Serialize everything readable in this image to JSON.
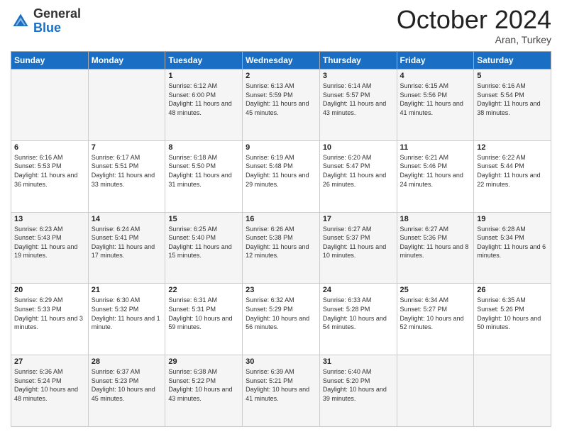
{
  "header": {
    "logo_general": "General",
    "logo_blue": "Blue",
    "month_title": "October 2024",
    "subtitle": "Aran, Turkey"
  },
  "days_of_week": [
    "Sunday",
    "Monday",
    "Tuesday",
    "Wednesday",
    "Thursday",
    "Friday",
    "Saturday"
  ],
  "weeks": [
    [
      {
        "day": "",
        "info": ""
      },
      {
        "day": "",
        "info": ""
      },
      {
        "day": "1",
        "info": "Sunrise: 6:12 AM\nSunset: 6:00 PM\nDaylight: 11 hours and 48 minutes."
      },
      {
        "day": "2",
        "info": "Sunrise: 6:13 AM\nSunset: 5:59 PM\nDaylight: 11 hours and 45 minutes."
      },
      {
        "day": "3",
        "info": "Sunrise: 6:14 AM\nSunset: 5:57 PM\nDaylight: 11 hours and 43 minutes."
      },
      {
        "day": "4",
        "info": "Sunrise: 6:15 AM\nSunset: 5:56 PM\nDaylight: 11 hours and 41 minutes."
      },
      {
        "day": "5",
        "info": "Sunrise: 6:16 AM\nSunset: 5:54 PM\nDaylight: 11 hours and 38 minutes."
      }
    ],
    [
      {
        "day": "6",
        "info": "Sunrise: 6:16 AM\nSunset: 5:53 PM\nDaylight: 11 hours and 36 minutes."
      },
      {
        "day": "7",
        "info": "Sunrise: 6:17 AM\nSunset: 5:51 PM\nDaylight: 11 hours and 33 minutes."
      },
      {
        "day": "8",
        "info": "Sunrise: 6:18 AM\nSunset: 5:50 PM\nDaylight: 11 hours and 31 minutes."
      },
      {
        "day": "9",
        "info": "Sunrise: 6:19 AM\nSunset: 5:48 PM\nDaylight: 11 hours and 29 minutes."
      },
      {
        "day": "10",
        "info": "Sunrise: 6:20 AM\nSunset: 5:47 PM\nDaylight: 11 hours and 26 minutes."
      },
      {
        "day": "11",
        "info": "Sunrise: 6:21 AM\nSunset: 5:46 PM\nDaylight: 11 hours and 24 minutes."
      },
      {
        "day": "12",
        "info": "Sunrise: 6:22 AM\nSunset: 5:44 PM\nDaylight: 11 hours and 22 minutes."
      }
    ],
    [
      {
        "day": "13",
        "info": "Sunrise: 6:23 AM\nSunset: 5:43 PM\nDaylight: 11 hours and 19 minutes."
      },
      {
        "day": "14",
        "info": "Sunrise: 6:24 AM\nSunset: 5:41 PM\nDaylight: 11 hours and 17 minutes."
      },
      {
        "day": "15",
        "info": "Sunrise: 6:25 AM\nSunset: 5:40 PM\nDaylight: 11 hours and 15 minutes."
      },
      {
        "day": "16",
        "info": "Sunrise: 6:26 AM\nSunset: 5:38 PM\nDaylight: 11 hours and 12 minutes."
      },
      {
        "day": "17",
        "info": "Sunrise: 6:27 AM\nSunset: 5:37 PM\nDaylight: 11 hours and 10 minutes."
      },
      {
        "day": "18",
        "info": "Sunrise: 6:27 AM\nSunset: 5:36 PM\nDaylight: 11 hours and 8 minutes."
      },
      {
        "day": "19",
        "info": "Sunrise: 6:28 AM\nSunset: 5:34 PM\nDaylight: 11 hours and 6 minutes."
      }
    ],
    [
      {
        "day": "20",
        "info": "Sunrise: 6:29 AM\nSunset: 5:33 PM\nDaylight: 11 hours and 3 minutes."
      },
      {
        "day": "21",
        "info": "Sunrise: 6:30 AM\nSunset: 5:32 PM\nDaylight: 11 hours and 1 minute."
      },
      {
        "day": "22",
        "info": "Sunrise: 6:31 AM\nSunset: 5:31 PM\nDaylight: 10 hours and 59 minutes."
      },
      {
        "day": "23",
        "info": "Sunrise: 6:32 AM\nSunset: 5:29 PM\nDaylight: 10 hours and 56 minutes."
      },
      {
        "day": "24",
        "info": "Sunrise: 6:33 AM\nSunset: 5:28 PM\nDaylight: 10 hours and 54 minutes."
      },
      {
        "day": "25",
        "info": "Sunrise: 6:34 AM\nSunset: 5:27 PM\nDaylight: 10 hours and 52 minutes."
      },
      {
        "day": "26",
        "info": "Sunrise: 6:35 AM\nSunset: 5:26 PM\nDaylight: 10 hours and 50 minutes."
      }
    ],
    [
      {
        "day": "27",
        "info": "Sunrise: 6:36 AM\nSunset: 5:24 PM\nDaylight: 10 hours and 48 minutes."
      },
      {
        "day": "28",
        "info": "Sunrise: 6:37 AM\nSunset: 5:23 PM\nDaylight: 10 hours and 45 minutes."
      },
      {
        "day": "29",
        "info": "Sunrise: 6:38 AM\nSunset: 5:22 PM\nDaylight: 10 hours and 43 minutes."
      },
      {
        "day": "30",
        "info": "Sunrise: 6:39 AM\nSunset: 5:21 PM\nDaylight: 10 hours and 41 minutes."
      },
      {
        "day": "31",
        "info": "Sunrise: 6:40 AM\nSunset: 5:20 PM\nDaylight: 10 hours and 39 minutes."
      },
      {
        "day": "",
        "info": ""
      },
      {
        "day": "",
        "info": ""
      }
    ]
  ]
}
